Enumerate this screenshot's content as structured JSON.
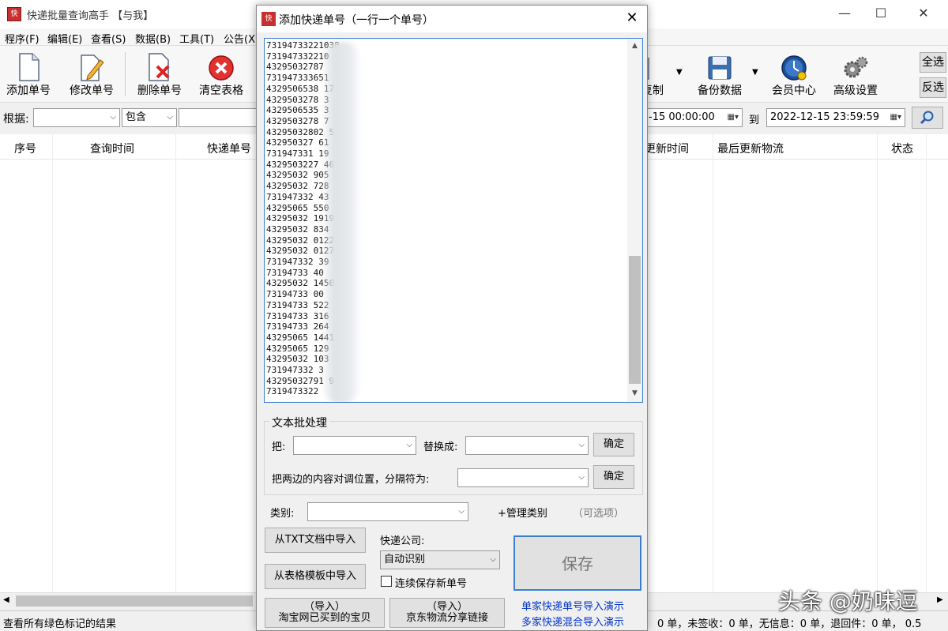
{
  "app": {
    "title": "快递批量查询高手 【与我】",
    "min": "—",
    "max": "☐",
    "close": "✕"
  },
  "menu": [
    "程序(F)",
    "编辑(E)",
    "查看(S)",
    "数据(B)",
    "工具(T)",
    "公告(X"
  ],
  "toolbar": {
    "add": "添加单号",
    "edit": "修改单号",
    "delete": "删除单号",
    "clear": "清空表格",
    "copy_partial": "复制",
    "backup": "备份数据",
    "member": "会员中心",
    "advanced": "高级设置",
    "select_all": "全选",
    "invert": "反选"
  },
  "filter": {
    "basis_label": "根据:",
    "basis_value": "",
    "match_value": "包含",
    "start_partial": "-15 00:00:00",
    "to_label": "到",
    "end_value": "2022-12-15 23:59:59",
    "search_icon": "magnifier-icon"
  },
  "grid": {
    "headers": [
      "序号",
      "查询时间",
      "快递单号",
      "更新时间",
      "最后更新物流",
      "状态"
    ]
  },
  "status": {
    "left": "查看所有绿色标记的结果",
    "right": "0 单，未签收：0 单，无信息：0 单，退回件：0 单， 0.5"
  },
  "dialog": {
    "title": "添加快递单号（一行一个单号）",
    "close": "✕",
    "numbers": [
      "73194733221038",
      "731947332210",
      "43295032787",
      "731947333651",
      "4329506538  17",
      "4329503278   3",
      "4329506535   3",
      "4329503278   7",
      "43295032802  5",
      "432950327    61",
      "731947331   19",
      "4329503227  461",
      "43295032   905",
      "43295032    728",
      "731947332   43",
      "43295065    550",
      "43295032   1919",
      "43295032   834",
      "43295032   0122",
      "43295032   0127",
      "731947332   39",
      "73194733    40",
      "43295032   1450",
      "73194733    00",
      "73194733   522",
      "73194733   316",
      "73194733   264",
      "43295065   1441",
      "43295065   129",
      "43295032   103",
      "731947332   3",
      "43295032791  9",
      "7319473322"
    ],
    "batch_group": "文本批处理",
    "replace_from_label": "把:",
    "replace_to_label": "替换成:",
    "ok1": "确定",
    "swap_label": "把两边的内容对调位置，分隔符为:",
    "ok2": "确定",
    "category_label": "类别:",
    "manage_category": "+管理类别",
    "optional": "（可选项）",
    "import_txt": "从TXT文档中导入",
    "import_table": "从表格模板中导入",
    "company_label": "快递公司:",
    "company_value": "自动识别",
    "keep_saving": "连续保存新单号",
    "save": "保存",
    "taobao_line1": "（导入）",
    "taobao_line2": "淘宝网已买到的宝贝",
    "jd_line1": "（导入）",
    "jd_line2": "京东物流分享链接",
    "demo_single": "单家快递单号导入演示",
    "demo_multi": "多家快递混合导入演示"
  },
  "watermark": "头条 @奶味逗"
}
